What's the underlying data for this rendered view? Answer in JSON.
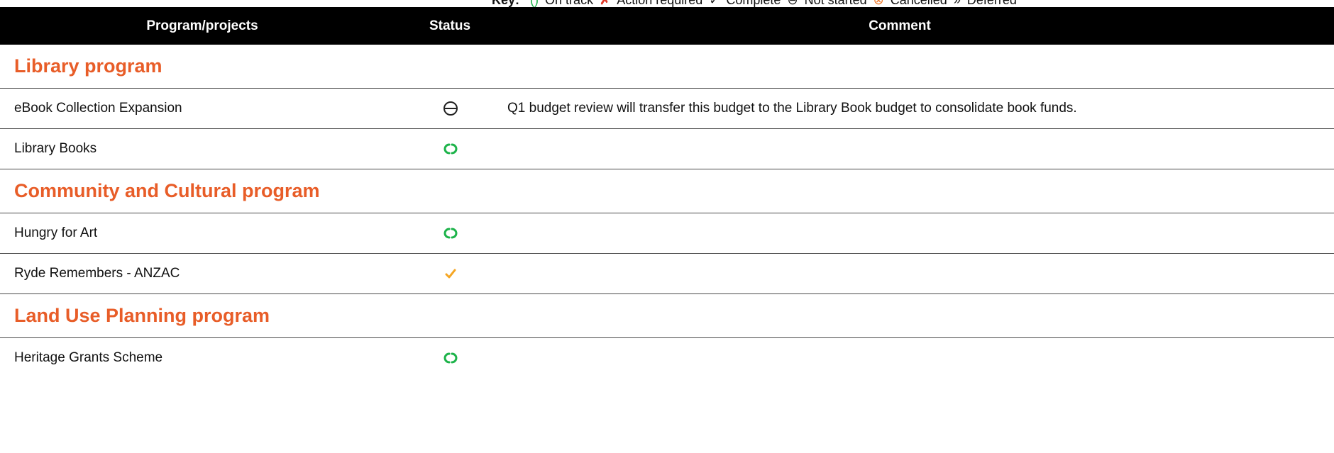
{
  "key": {
    "label": "Key:",
    "items": [
      {
        "symbol": "()",
        "text": "On track",
        "icon": "on-track-icon",
        "color": "#1db34a"
      },
      {
        "symbol": "✗",
        "text": "Action required",
        "icon": "action-required-icon",
        "color": "#e03a2a"
      },
      {
        "symbol": "✓",
        "text": "Complete",
        "icon": "complete-icon",
        "color": "#222222"
      },
      {
        "symbol": "⊖",
        "text": "Not started",
        "icon": "not-started-icon",
        "color": "#222222"
      },
      {
        "symbol": "⊗",
        "text": "Cancelled",
        "icon": "cancelled-icon",
        "color": "#f07a2c"
      },
      {
        "symbol": "»",
        "text": "Deferred",
        "icon": "deferred-icon",
        "color": "#222222"
      }
    ]
  },
  "columns": {
    "program": "Program/projects",
    "status": "Status",
    "comment": "Comment"
  },
  "sections": [
    {
      "title": "Library program",
      "rows": [
        {
          "name": "eBook Collection Expansion",
          "status": "not-started",
          "comment": "Q1 budget review will transfer this budget to the Library Book budget to consolidate book funds."
        },
        {
          "name": "Library Books",
          "status": "on-track",
          "comment": ""
        }
      ]
    },
    {
      "title": "Community and Cultural program",
      "rows": [
        {
          "name": "Hungry for Art",
          "status": "on-track",
          "comment": ""
        },
        {
          "name": "Ryde Remembers - ANZAC",
          "status": "complete",
          "comment": ""
        }
      ]
    },
    {
      "title": "Land Use Planning program",
      "rows": [
        {
          "name": "Heritage Grants Scheme",
          "status": "on-track",
          "comment": ""
        }
      ]
    }
  ],
  "colors": {
    "header_bg": "#000000",
    "section_title": "#e85d28",
    "on_track": "#1db34a",
    "complete": "#f5a623",
    "not_started": "#222222"
  }
}
